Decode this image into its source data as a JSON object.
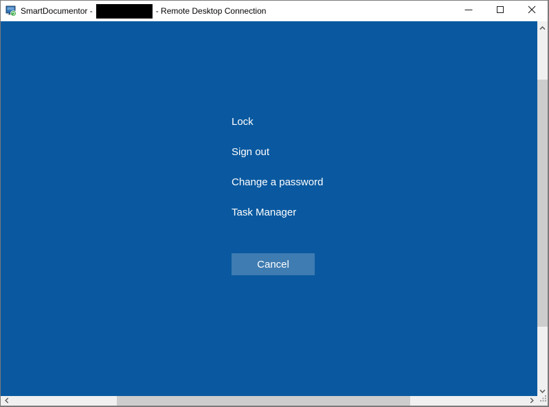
{
  "window": {
    "title_prefix": "SmartDocumentor -",
    "title_redacted": true,
    "title_suffix": "- Remote Desktop Connection",
    "controls": {
      "minimize": "minimize",
      "maximize": "maximize",
      "close": "close"
    }
  },
  "security_screen": {
    "options": [
      {
        "label": "Lock"
      },
      {
        "label": "Sign out"
      },
      {
        "label": "Change a password"
      },
      {
        "label": "Task Manager"
      }
    ],
    "cancel_label": "Cancel"
  },
  "colors": {
    "screen_background": "#0a59a0",
    "cancel_button": "#3f7cb1",
    "titlebar_background": "#ffffff",
    "title_text": "#000000",
    "menu_text": "#ffffff",
    "scrollbar_track": "#f0f0f0",
    "scrollbar_thumb": "#cdcdcd",
    "redaction_box": "#000000",
    "window_border": "#7a7a7a"
  },
  "icons": {
    "app": "rdp-monitor-icon",
    "minimize": "–",
    "maximize": "□",
    "close": "✕",
    "scroll_up": "chevron-up",
    "scroll_down": "chevron-down",
    "scroll_left": "chevron-left",
    "scroll_right": "chevron-right",
    "resize_grip": "dot-grid"
  }
}
